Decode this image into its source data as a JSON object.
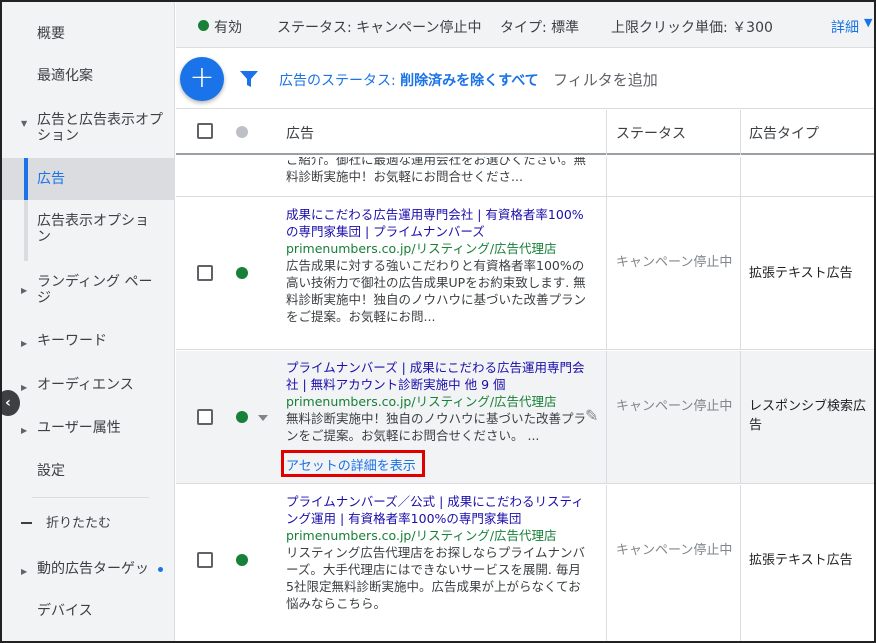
{
  "sidebar": {
    "items": [
      {
        "label": "概要"
      },
      {
        "label": "最適化案"
      },
      {
        "label_line1": "広告と広告表示オプ",
        "label_line2": "ション"
      },
      {
        "label": "広告"
      },
      {
        "label_line1": "広告表示オプショ",
        "label_line2": "ン"
      },
      {
        "label_line1": "ランディング ペー",
        "label_line2": "ジ"
      },
      {
        "label": "キーワード"
      },
      {
        "label": "オーディエンス"
      },
      {
        "label": "ユーザー属性"
      },
      {
        "label": "設定"
      },
      {
        "label": "折りたたむ"
      },
      {
        "label": "動的広告ターゲッ"
      },
      {
        "label": "デバイス"
      }
    ],
    "back_icon": "chevron-left-icon"
  },
  "status_bar": {
    "state": "有効",
    "status": "ステータス: キャンペーン停止中",
    "type": "タイプ: 標準",
    "max_cpc": "上限クリック単価: ￥300",
    "details": "詳細"
  },
  "filter_bar": {
    "filter_prefix": "広告のステータス:",
    "filter_value": "削除済みを除くすべて",
    "add_filter": "フィルタを追加"
  },
  "table": {
    "headers": {
      "ad": "広告",
      "status": "ステータス",
      "type": "広告タイプ"
    },
    "rows": [
      {
        "title": "",
        "url": "",
        "desc": "ご紹介。御社に最適な運用会社をお選びください。無料診断実施中！お気軽にお問合せくださ...",
        "status": "",
        "type": ""
      },
      {
        "title": "成果にこだわる広告運用専門会社 | 有資格者率100%の専門家集団 | プライムナンバーズ",
        "url": "primenumbers.co.jp/リスティング/広告代理店",
        "desc": "広告成果に対する強いこだわりと有資格者率100%の高い技術力で御社の広告成果UPをお約束致します. 無料診断実施中！独自のノウハウに基づいた改善プランをご提案。お気軽にお問...",
        "status": "キャンペーン停止中",
        "type": "拡張テキスト広告"
      },
      {
        "title": "プライムナンバーズ | 成果にこだわる広告運用専門会社 | 無料アカウント診断実施中 他 9 個",
        "url": "primenumbers.co.jp/リスティング/広告代理店",
        "desc": "無料診断実施中！独自のノウハウに基づいた改善プランをご提案。お気軽にお問合せください。 ...",
        "asset_link": "アセットの詳細を表示",
        "status": "キャンペーン停止中",
        "type": "レスポンシブ検索広告"
      },
      {
        "title": "プライムナンバーズ／公式 | 成果にこだわるリスティング運用 | 有資格者率100%の専門家集団",
        "url": "primenumbers.co.jp/リスティング/広告代理店",
        "desc": "リスティング広告代理店をお探しならプライムナンバーズ。大手代理店にはできないサービスを展開. 毎月5社限定無料診断実施中。広告成果が上がらなくてお悩みならこちら。",
        "status": "キャンペーン停止中",
        "type": "拡張テキスト広告"
      }
    ]
  },
  "colors": {
    "accent": "#1a73e8",
    "enabled": "#188038",
    "highlight": "#e00000"
  }
}
